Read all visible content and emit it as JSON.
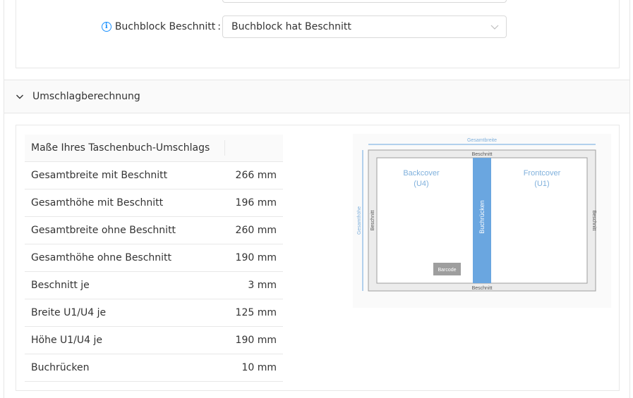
{
  "form": {
    "info_icon": "info-icon",
    "label": "Buchblock Beschnitt",
    "colon": ":",
    "selected_value": "Buchblock hat Beschnitt",
    "arrow_icon": "chevron-down-icon"
  },
  "section": {
    "title": "Umschlagberechnung",
    "toggle_icon": "chevron-down-icon"
  },
  "table": {
    "header": "Maße Ihres Taschenbuch-Umschlags",
    "rows": [
      {
        "label": "Gesamtbreite mit Beschnitt",
        "value": "266 mm"
      },
      {
        "label": "Gesamthöhe mit Beschnitt",
        "value": "196 mm"
      },
      {
        "label": "Gesamtbreite ohne Beschnitt",
        "value": "260 mm"
      },
      {
        "label": "Gesamthöhe ohne Beschnitt",
        "value": "190 mm"
      },
      {
        "label": "Beschnitt je",
        "value": "3 mm"
      },
      {
        "label": "Breite U1/U4 je",
        "value": "125 mm"
      },
      {
        "label": "Höhe U1/U4 je",
        "value": "190 mm"
      },
      {
        "label": "Buchrücken",
        "value": "10 mm"
      }
    ]
  },
  "diagram": {
    "total_width": "Gesamtbreite",
    "total_height": "Gesamthöhe",
    "bleed_top": "Beschnitt",
    "bleed_bottom": "Beschnitt",
    "bleed_left": "Beschnitt",
    "bleed_right": "Beschnitt",
    "backcover": "Backcover",
    "backcover_code": "(U4)",
    "frontcover": "Frontcover",
    "frontcover_code": "(U1)",
    "spine": "Buchrücken",
    "barcode": "Barcode",
    "colors": {
      "accent": "#6aa6e0",
      "label": "#7fb0dc",
      "frame": "#9e9e9e",
      "barcode": "#9e9e9e"
    }
  }
}
